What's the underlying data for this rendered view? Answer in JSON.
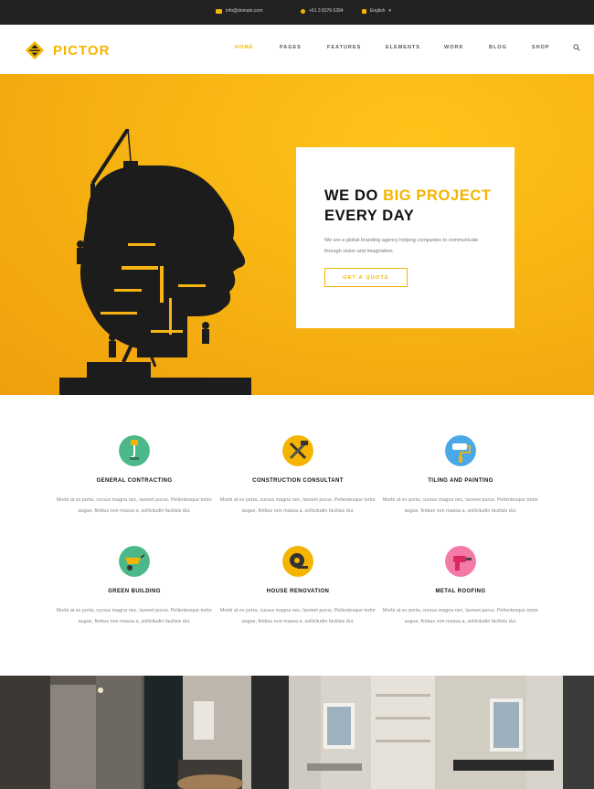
{
  "topbar": {
    "email": "info@domain.com",
    "phone": "+61 3 8376 6284",
    "language": "English"
  },
  "brand": {
    "name": "PICTOR",
    "accent": "#f5b400",
    "dark": "#222222"
  },
  "nav": {
    "items": [
      "HOME",
      "PAGES",
      "FEATURES",
      "ELEMENTS",
      "WORK",
      "BLOG",
      "SHOP"
    ],
    "active": "HOME",
    "search_icon": "search-icon"
  },
  "hero": {
    "title_line1_plain": "WE DO",
    "title_line1_highlight": "BIG PROJECT",
    "title_line2": "EVERY DAY",
    "description": "We are a global branding agency helping companies to communicate through vision and imagination.",
    "button": "GET A QUOTE"
  },
  "services": [
    {
      "title": "GENERAL CONTRACTING",
      "icon": "crane-hook-icon",
      "color": "#4cb88a",
      "text": "Morbi at ex porta, cursus magna nec, laoreet purus. Pellentesque tortor augue, finibus non massa a, sollicitudin facilisis dui."
    },
    {
      "title": "CONSTRUCTION CONSULTANT",
      "icon": "tools-icon",
      "color": "#f5b400",
      "text": "Morbi at ex porta, cursus magna nec, laoreet purus. Pellentesque tortor augue, finibus non massa a, sollicitudin facilisis dui."
    },
    {
      "title": "TILING AND PAINTING",
      "icon": "paint-roller-icon",
      "color": "#4aa8e8",
      "text": "Morbi at ex porta, cursus magna nec, laoreet purus. Pellentesque tortor augue, finibus non massa a, sollicitudin facilisis dui."
    },
    {
      "title": "GREEN BUILDING",
      "icon": "wheelbarrow-icon",
      "color": "#4cb88a",
      "text": "Morbi at ex porta, cursus magna nec, laoreet purus. Pellentesque tortor augue, finibus non massa a, sollicitudin facilisis dui."
    },
    {
      "title": "HOUSE RENOVATION",
      "icon": "tape-measure-icon",
      "color": "#f5b400",
      "text": "Morbi at ex porta, cursus magna nec, laoreet purus. Pellentesque tortor augue, finibus non massa a, sollicitudin facilisis dui."
    },
    {
      "title": "METAL ROOFING",
      "icon": "drill-icon",
      "color": "#f47aa8",
      "text": "Morbi at ex porta, cursus magna nec, laoreet purus. Pellentesque tortor augue, finibus non massa a, sollicitudin facilisis dui."
    }
  ],
  "gallery": {
    "images": [
      "interior-living-room-photo",
      "interior-kitchen-shelves-photo"
    ]
  }
}
